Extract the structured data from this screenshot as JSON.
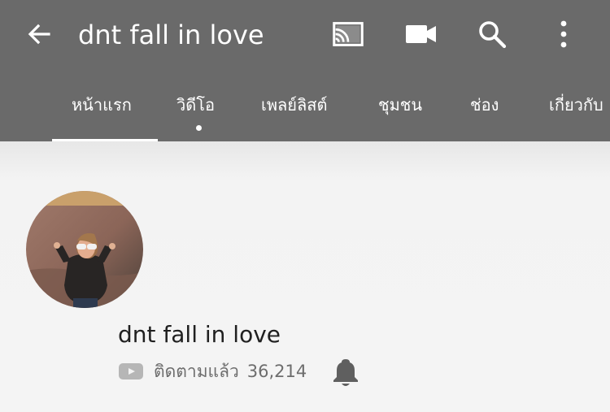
{
  "colors": {
    "app_bar": "#6a6a6a",
    "text_on_bar": "#ffffff",
    "page_background": "#f4f4f4",
    "channel_text": "#202020",
    "secondary_text": "#6d6d6d"
  },
  "header": {
    "title": "dnt fall in love",
    "icons": [
      "back-arrow-icon",
      "cast-icon",
      "video-camera-icon",
      "search-icon",
      "more-vertical-icon"
    ]
  },
  "tabs": [
    {
      "label": "หน้าแรก",
      "active": true
    },
    {
      "label": "วิดีโอ",
      "active": false
    },
    {
      "label": "เพลย์ลิสต์",
      "active": false
    },
    {
      "label": "ชุมชน",
      "active": false
    },
    {
      "label": "ช่อง",
      "active": false
    },
    {
      "label": "เกี่ยวกับ",
      "active": false
    }
  ],
  "channel": {
    "name": "dnt fall in love",
    "subscription_label": "ติดตามแล้ว",
    "subscriber_count": "36,214",
    "icons": [
      "youtube-small-icon",
      "bell-icon"
    ]
  }
}
